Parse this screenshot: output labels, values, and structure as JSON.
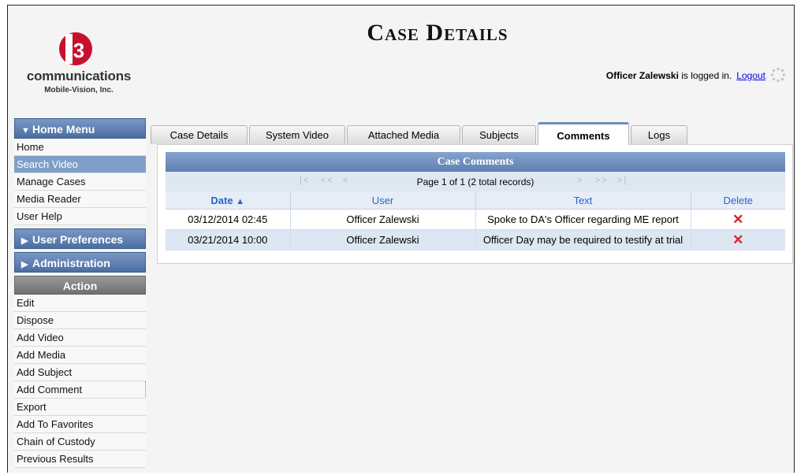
{
  "header": {
    "title": "Case Details",
    "logo_text": "communications",
    "logo_sub": "Mobile-Vision, Inc.",
    "user_name": "Officer Zalewski",
    "login_suffix": " is logged in.",
    "logout_label": "Logout"
  },
  "sidebar": {
    "home_menu_title": "Home Menu",
    "home_items": [
      "Home",
      "Search Video",
      "Manage Cases",
      "Media Reader",
      "User Help"
    ],
    "active_item": "Search Video",
    "user_prefs_title": "User Preferences",
    "admin_title": "Administration",
    "action_title": "Action",
    "action_items": [
      "Edit",
      "Dispose",
      "Add Video",
      "Add Media",
      "Add Subject",
      "Add Comment",
      "Export",
      "Add To Favorites",
      "Chain of Custody",
      "Previous Results"
    ]
  },
  "tabs": [
    "Case Details",
    "System Video",
    "Attached Media",
    "Subjects",
    "Comments",
    "Logs"
  ],
  "active_tab": "Comments",
  "comments": {
    "title": "Case Comments",
    "pager_text": "Page 1 of 1 (2 total records)",
    "columns": [
      "Date",
      "User",
      "Text",
      "Delete"
    ],
    "rows": [
      {
        "date": "03/12/2014 02:45",
        "user": "Officer Zalewski",
        "text": "Spoke to DA's Officer regarding ME report"
      },
      {
        "date": "03/21/2014 10:00",
        "user": "Officer Zalewski",
        "text": "Officer Day may be required to testify at trial"
      }
    ]
  },
  "colors": {
    "accent": "#5d80b3",
    "delete": "#dd2222",
    "link": "#0000ee"
  }
}
